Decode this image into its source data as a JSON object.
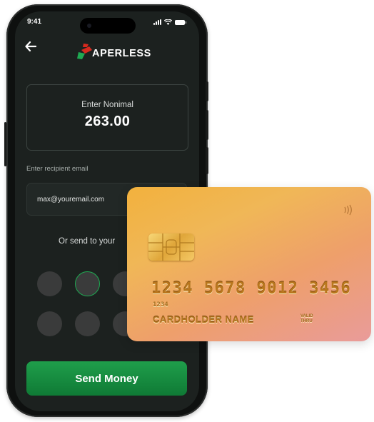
{
  "status_bar": {
    "time": "9:41"
  },
  "header": {
    "logo_text": "APERLESS"
  },
  "amount": {
    "label": "Enter Nonimal",
    "value": "263.00"
  },
  "recipient": {
    "label": "Enter recipient email",
    "value": "max@youremail.com"
  },
  "contacts": {
    "prompt": "Or send to your"
  },
  "actions": {
    "send_label": "Send Money"
  },
  "card": {
    "number": "1234 5678 9012 3456",
    "small_number": "1234",
    "holder": "CARDHOLDER NAME",
    "valid_line1": "VALID",
    "valid_line2": "THRU"
  },
  "colors": {
    "accent_green": "#1a9b49",
    "screen_bg": "#1c211f",
    "card_gold": "#f2b13d"
  },
  "icons": [
    "back-arrow-icon",
    "signal-icon",
    "wifi-icon",
    "battery-icon",
    "logo-icon",
    "contactless-icon",
    "chip-icon"
  ]
}
